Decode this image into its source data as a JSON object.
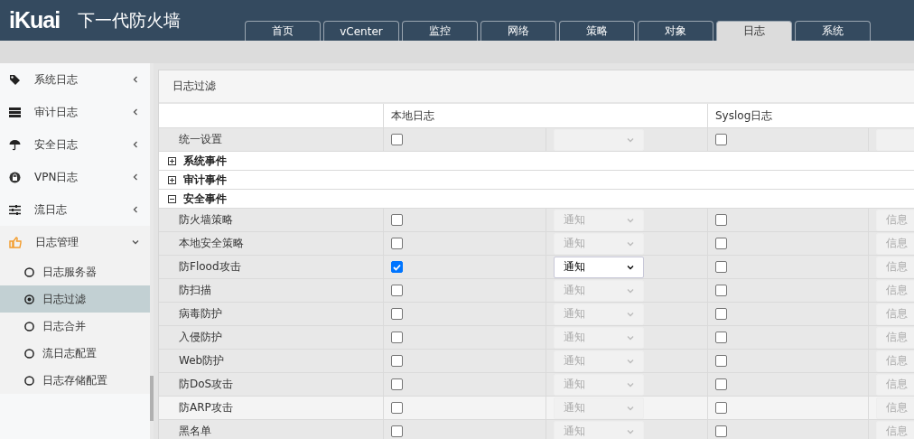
{
  "header": {
    "logo": "iKuai",
    "title": "下一代防火墙",
    "tabs": [
      {
        "label": "首页",
        "selected": false
      },
      {
        "label": "vCenter",
        "selected": false
      },
      {
        "label": "监控",
        "selected": false
      },
      {
        "label": "网络",
        "selected": false
      },
      {
        "label": "策略",
        "selected": false
      },
      {
        "label": "对象",
        "selected": false
      },
      {
        "label": "日志",
        "selected": true
      },
      {
        "label": "系统",
        "selected": false
      }
    ]
  },
  "sidebar": {
    "items": [
      {
        "label": "系统日志",
        "expanded": false
      },
      {
        "label": "审计日志",
        "expanded": false
      },
      {
        "label": "安全日志",
        "expanded": false
      },
      {
        "label": "VPN日志",
        "expanded": false
      },
      {
        "label": "流日志",
        "expanded": false
      },
      {
        "label": "日志管理",
        "expanded": true,
        "children": [
          {
            "label": "日志服务器",
            "selected": false
          },
          {
            "label": "日志过滤",
            "selected": true
          },
          {
            "label": "日志合并",
            "selected": false
          },
          {
            "label": "流日志配置",
            "selected": false
          },
          {
            "label": "日志存储配置",
            "selected": false
          }
        ]
      }
    ]
  },
  "panel": {
    "title": "日志过滤",
    "columns": [
      "本地日志",
      "Syslog日志"
    ],
    "unified": {
      "label": "统一设置",
      "local_checked": false,
      "syslog_checked": false
    },
    "groups": [
      {
        "label": "系统事件",
        "expanded": false
      },
      {
        "label": "审计事件",
        "expanded": false
      },
      {
        "label": "安全事件",
        "expanded": true,
        "rows": [
          {
            "label": "防火墙策略",
            "local_checked": false,
            "local_level": "通知",
            "syslog_checked": false,
            "syslog_level": "信息",
            "hovered": false
          },
          {
            "label": "本地安全策略",
            "local_checked": false,
            "local_level": "通知",
            "syslog_checked": false,
            "syslog_level": "信息",
            "hovered": false
          },
          {
            "label": "防Flood攻击",
            "local_checked": true,
            "local_level": "通知",
            "syslog_checked": false,
            "syslog_level": "信息",
            "hovered": false
          },
          {
            "label": "防扫描",
            "local_checked": false,
            "local_level": "通知",
            "syslog_checked": false,
            "syslog_level": "信息",
            "hovered": false
          },
          {
            "label": "病毒防护",
            "local_checked": false,
            "local_level": "通知",
            "syslog_checked": false,
            "syslog_level": "信息",
            "hovered": false
          },
          {
            "label": "入侵防护",
            "local_checked": false,
            "local_level": "通知",
            "syslog_checked": false,
            "syslog_level": "信息",
            "hovered": false
          },
          {
            "label": "Web防护",
            "local_checked": false,
            "local_level": "通知",
            "syslog_checked": false,
            "syslog_level": "信息",
            "hovered": false
          },
          {
            "label": "防DoS攻击",
            "local_checked": false,
            "local_level": "通知",
            "syslog_checked": false,
            "syslog_level": "信息",
            "hovered": false
          },
          {
            "label": "防ARP攻击",
            "local_checked": false,
            "local_level": "通知",
            "syslog_checked": false,
            "syslog_level": "信息",
            "hovered": true
          },
          {
            "label": "黑名单",
            "local_checked": false,
            "local_level": "通知",
            "syslog_checked": false,
            "syslog_level": "信息",
            "hovered": false
          }
        ]
      }
    ]
  }
}
